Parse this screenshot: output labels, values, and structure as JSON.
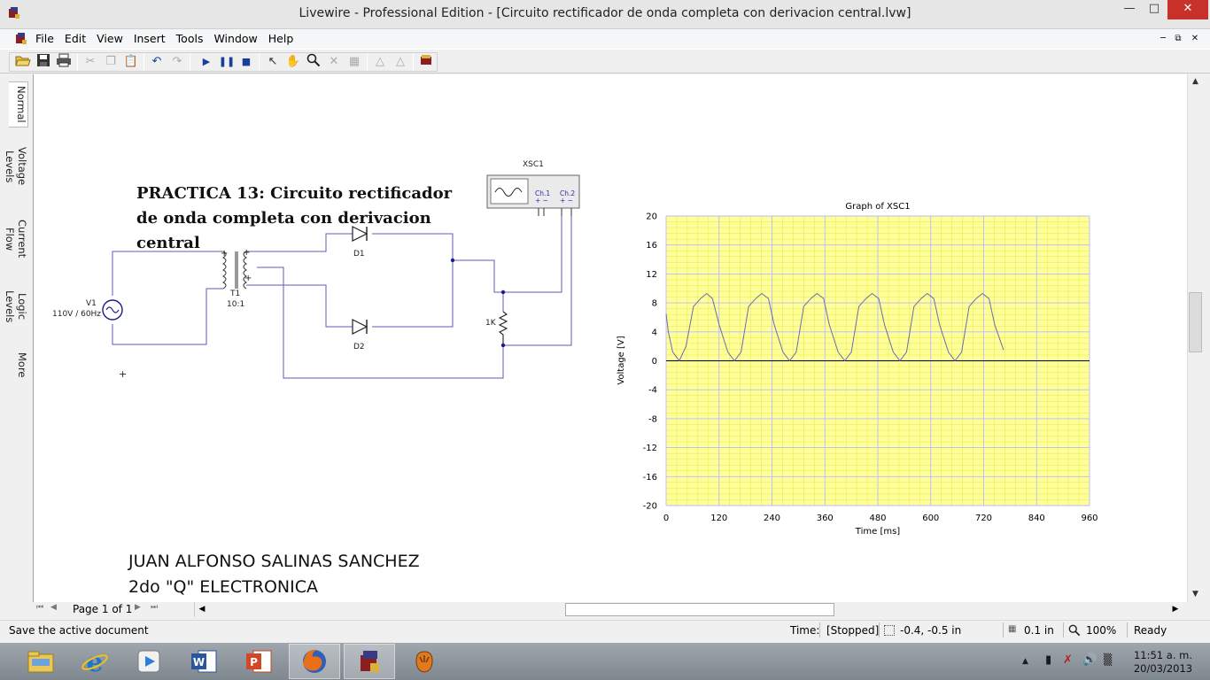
{
  "window": {
    "title": "Livewire - Professional Edition - [Circuito rectificador de onda completa con derivacion central.lvw]"
  },
  "menu": [
    "File",
    "Edit",
    "View",
    "Insert",
    "Tools",
    "Window",
    "Help"
  ],
  "toolbar": {
    "icons": [
      "open-icon",
      "save-icon",
      "print-icon",
      "cut-icon",
      "copy-icon",
      "paste-icon",
      "undo-icon",
      "redo-icon",
      "play-icon",
      "pause-icon",
      "stop-icon",
      "pointer-icon",
      "hand-icon",
      "zoom-icon",
      "wire-cut-icon",
      "component-icon",
      "rotate-left-icon",
      "rotate-right-icon",
      "gallery-icon"
    ]
  },
  "side_tabs": [
    "Normal",
    "Voltage Levels",
    "Current Flow",
    "Logic Levels",
    "More"
  ],
  "document": {
    "title_lines": [
      "PRACTICA 13: Circuito rectificador",
      "de onda completa con derivacion",
      "central"
    ],
    "author_lines": [
      "JUAN ALFONSO SALINAS SANCHEZ",
      "2do \"Q\" ELECTRONICA"
    ]
  },
  "circuit": {
    "source_name": "V1",
    "source_value": "110V / 60Hz",
    "transformer_name": "T1",
    "transformer_ratio": "10:1",
    "diode1": "D1",
    "diode2": "D2",
    "resistor": "1K",
    "scope_name": "XSC1",
    "scope_ch1": "Ch.1",
    "scope_ch2": "Ch.2",
    "scope_pm": "+ −"
  },
  "chart_data": {
    "type": "line",
    "title": "Graph of XSC1",
    "xlabel": "Time [ms]",
    "ylabel": "Voltage [V]",
    "xlim": [
      0,
      960
    ],
    "ylim": [
      -20,
      20
    ],
    "xticks": [
      0,
      120,
      240,
      360,
      480,
      600,
      720,
      840,
      960
    ],
    "yticks": [
      20,
      16,
      12,
      8,
      4,
      0,
      -4,
      -8,
      -12,
      -16,
      -20
    ],
    "grid": true,
    "background_color": "#ffff99",
    "grid_color": "#b9b9ff",
    "line_color": "#6a6ab6",
    "series": [
      {
        "x": [
          0,
          5,
          15,
          30,
          45,
          62,
          78,
          92,
          105,
          120,
          140,
          155,
          170,
          187,
          203,
          217,
          232,
          245,
          265,
          280,
          295,
          312,
          328,
          342,
          357,
          370,
          390,
          405,
          420,
          437,
          453,
          467,
          482,
          495,
          515,
          530,
          545,
          562,
          578,
          592,
          607,
          620,
          640,
          655,
          670,
          687,
          703,
          717,
          732,
          745,
          765
        ],
        "y": [
          6.5,
          4,
          1.2,
          0,
          2,
          7.5,
          8.6,
          9.3,
          8.6,
          5,
          1.2,
          0,
          1.2,
          7.5,
          8.6,
          9.3,
          8.6,
          5,
          1.2,
          0,
          1.2,
          7.5,
          8.6,
          9.3,
          8.6,
          5,
          1.2,
          0,
          1.2,
          7.5,
          8.6,
          9.3,
          8.6,
          5,
          1.2,
          0,
          1.2,
          7.5,
          8.6,
          9.3,
          8.6,
          5,
          1.2,
          0,
          1.2,
          7.5,
          8.6,
          9.3,
          8.6,
          5,
          1.5
        ]
      }
    ]
  },
  "pager": {
    "page_label": "Page 1 of 1"
  },
  "status": {
    "message": "Save the active document",
    "time_label": "Time:",
    "time_value": "[Stopped]",
    "coords": "-0.4, -0.5 in",
    "grid": "0.1 in",
    "zoom": "100%",
    "ready": "Ready"
  },
  "taskbar": {
    "apps": [
      "file-explorer-icon",
      "internet-explorer-icon",
      "media-player-icon",
      "word-icon",
      "powerpoint-icon",
      "firefox-icon",
      "livewire-icon",
      "fireworks-icon"
    ],
    "time": "11:51 a. m.",
    "date": "20/03/2013"
  },
  "colors": {
    "wire": "#5d5db5",
    "close_button": "#c7312a"
  }
}
